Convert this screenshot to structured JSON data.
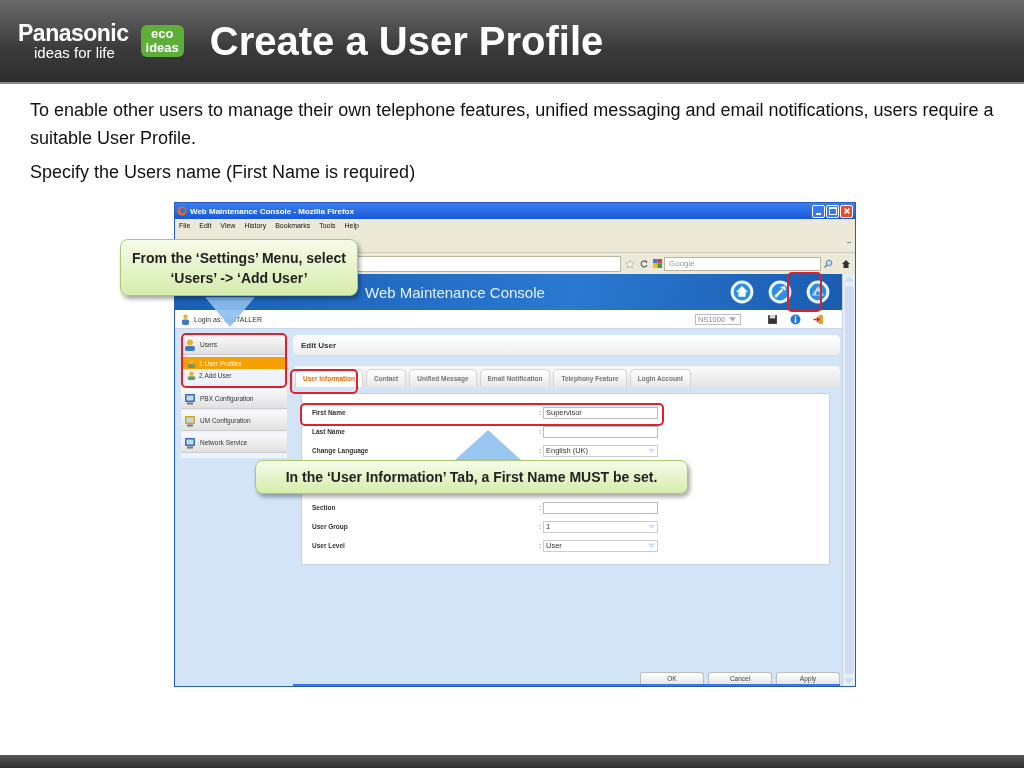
{
  "header": {
    "brand": "Panasonic",
    "tagline": "ideas for life",
    "badge_top": "eco",
    "badge_bottom": "ideas",
    "title": "Create a User Profile"
  },
  "intro": [
    "To enable other users to manage their own telephone features, unified messaging and email notifications, users require a suitable User Profile.",
    "Specify the Users name (First Name is required)"
  ],
  "browser": {
    "title": "Web Maintenance Console - Mozilla Firefox",
    "menu": [
      "File",
      "Edit",
      "View",
      "History",
      "Bookmarks",
      "Tools",
      "Help"
    ],
    "search_placeholder": "Google",
    "banner": {
      "title": "Web Maintenance Console"
    },
    "login": "Login as: INSTALLER",
    "system_select": "NS1000",
    "sidebar": [
      {
        "label": "Users",
        "children": [
          {
            "label": "1.User Profiles",
            "selected": true
          },
          {
            "label": "2.Add User",
            "selected": false
          }
        ]
      },
      {
        "label": "PBX Configuration"
      },
      {
        "label": "UM Configuration"
      },
      {
        "label": "Network Service"
      }
    ],
    "panel_title": "Edit User",
    "tabs": [
      {
        "label": "User Information",
        "selected": true
      },
      {
        "label": "Contact",
        "selected": false
      },
      {
        "label": "Unified Message",
        "selected": false
      },
      {
        "label": "Email Notification",
        "selected": false
      },
      {
        "label": "Telephony Feature",
        "selected": false
      },
      {
        "label": "Login Account",
        "selected": false
      }
    ],
    "form": [
      {
        "label": "First Name",
        "kind": "text",
        "value": "Supervisor"
      },
      {
        "label": "Last Name",
        "kind": "text"
      },
      {
        "label": "Change Language",
        "kind": "select",
        "value": "English (UK)"
      },
      {
        "label": "Section",
        "kind": "text"
      },
      {
        "label": "User Group",
        "kind": "select",
        "value": "1"
      },
      {
        "label": "User Level",
        "kind": "select",
        "value": "User"
      }
    ],
    "buttons": [
      "OK",
      "Cancel",
      "Apply"
    ]
  },
  "callouts": [
    "From the ‘Settings’ Menu, select ‘Users’ -> ‘Add User’",
    "In the ‘User Information’ Tab, a First Name MUST be set."
  ]
}
